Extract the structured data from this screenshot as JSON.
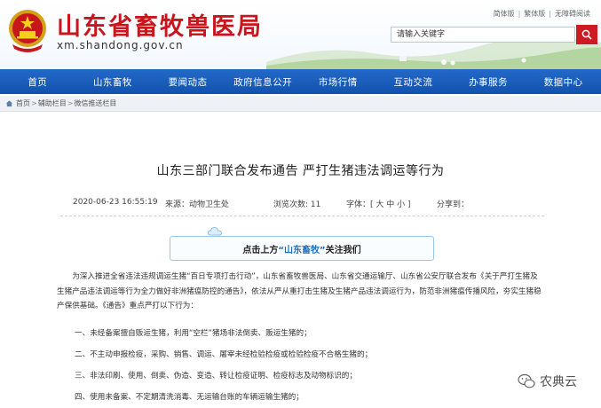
{
  "header": {
    "site_title": "山东省畜牧兽医局",
    "site_url": "xm.shandong.gov.cn",
    "top_links": [
      "简体版",
      "繁体版",
      "无障碍阅读"
    ],
    "search_placeholder": "请输入关键字"
  },
  "nav": {
    "items": [
      "首页",
      "山东畜牧",
      "要闻动态",
      "政府信息公开",
      "市场行情",
      "互动交流",
      "办事服务",
      "数据中心"
    ]
  },
  "breadcrumb": {
    "items": [
      "首页",
      "辅助栏目",
      "微信推送栏目"
    ]
  },
  "article": {
    "title": "山东三部门联合发布通告 严打生猪违法调运等行为",
    "date": "2020-06-23 16:55:19",
    "source": "来源：动物卫生处",
    "views": "浏览次数: 11",
    "font_size": "字体：[ 大 中 小 ]",
    "share": "分享到："
  },
  "follow": {
    "prefix": "点击上方",
    "account": "“山东畜牧”",
    "suffix": "关注我们"
  },
  "body": {
    "intro": "为深入推进全省违法违规调运生猪“百日专项打击行动”，山东省畜牧兽医局、山东省交通运输厅、山东省公安厅联合发布《关于严打生猪及生猪产品违法调运等行为全力做好非洲猪瘟防控的通告》，依法从严从重打击生猪及生猪产品违法调运行为，防范非洲猪瘟传播风险，夯实生猪稳产保供基础。《通告》重点严打以下行为：",
    "items": [
      "一、未经备案擅自贩运生猪，利用“空栏”猪场非法倒卖、贩运生猪的；",
      "二、不主动申报检疫，采购、销售、调运、屠宰未经检验检疫或检验检疫不合格生猪的；",
      "三、非法印刷、使用、倒卖、伪造、变造、转让检疫证明、检疫标志及动物标识的；",
      "四、使用未备案、不定期清洗消毒、无运输台账的车辆运输生猪的；"
    ]
  },
  "watermark": {
    "text": "农典云"
  },
  "colors": {
    "brand_red": "#c8161d",
    "nav_blue": "#1a5fbe",
    "search_red": "#cc1b22"
  }
}
